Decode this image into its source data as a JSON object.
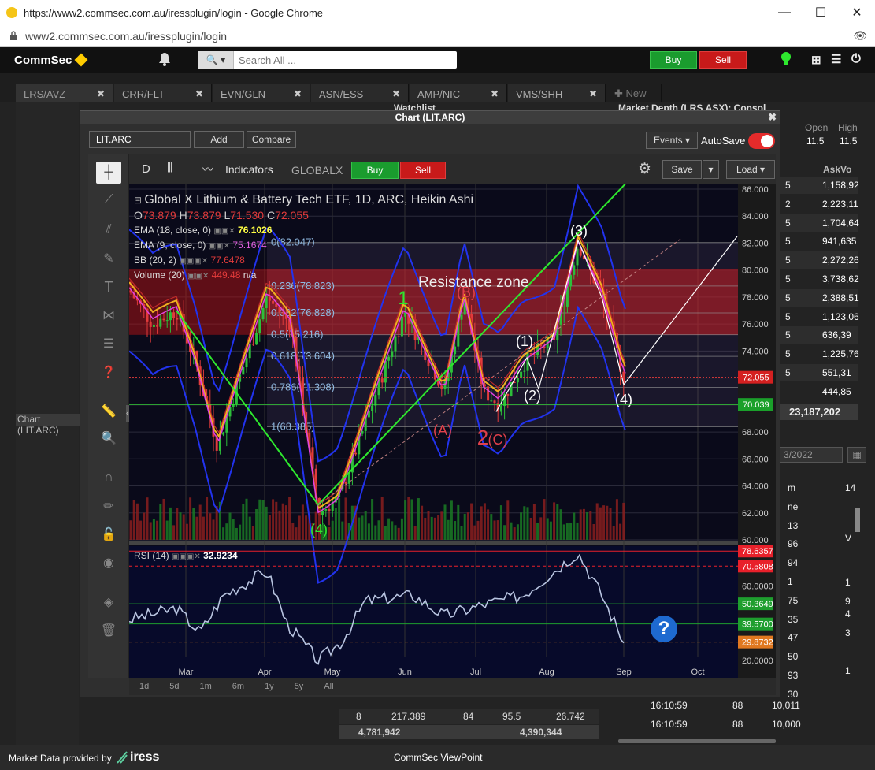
{
  "browser": {
    "title": "https://www2.commsec.com.au/iressplugin/login - Google Chrome",
    "url": "www2.commsec.com.au/iressplugin/login",
    "min": "—",
    "max": "☐",
    "close": "✕"
  },
  "header": {
    "logo": "CommSec",
    "search_placeholder": "Search All ...",
    "buy": "Buy",
    "sell": "Sell"
  },
  "tabs": [
    {
      "label": "LRS/AVZ"
    },
    {
      "label": "CRR/FLT"
    },
    {
      "label": "EVN/GLN"
    },
    {
      "label": "ASN/ESS"
    },
    {
      "label": "AMP/NIC"
    },
    {
      "label": "VMS/SHH"
    }
  ],
  "new_tab": "✚ New",
  "bg": {
    "watchlist": "Watchlist",
    "market_depth": "Market Depth (LRS.ASX): Consol...",
    "open_label": "Open",
    "high_label": "High",
    "open": "11.5",
    "high": "11.5",
    "askvol": "AskVo",
    "depth_vals": [
      "1,158,92",
      "2,223,11",
      "1,704,64",
      "941,635",
      "2,272,26",
      "3,738,62",
      "2,388,51",
      "1,123,06",
      "636,39",
      "1,225,76",
      "551,31",
      "444,85"
    ],
    "depth_idx": [
      "5",
      "2",
      "5",
      "5",
      "5",
      "5",
      "5",
      "5",
      "5",
      "5",
      "5"
    ],
    "depth_total": "23,187,202",
    "date_sel": "3/2022",
    "time_a": "16:10:59",
    "time_b": "16:10:59",
    "vol_a": "88",
    "vol_b": "88",
    "val_a": "10,011",
    "val_b": "10,000",
    "chart_side_label": "Chart (LIT.ARC)",
    "right_col": [
      "m",
      "ne",
      "13",
      "96",
      "94",
      "1",
      "75",
      "35",
      "47",
      "50",
      "93",
      "30"
    ],
    "right_col2": [
      "14",
      "V",
      "4",
      "3",
      "1",
      "1",
      "9"
    ],
    "bot_row": [
      "8",
      "217.389",
      "84",
      "95.5",
      "26.742"
    ],
    "bot_total_a": "4,781,942",
    "bot_total_b": "4,390,344"
  },
  "window": {
    "title": "Chart (LIT.ARC)",
    "symbol": "LIT.ARC",
    "add": "Add",
    "compare": "Compare",
    "events": "Events ▾",
    "autosave": "AutoSave"
  },
  "toolbar": {
    "interval": "D",
    "indicators": "Indicators",
    "exchange": "GLOBALX",
    "buy": "Buy",
    "sell": "Sell",
    "save": "Save",
    "load": "Load ▾"
  },
  "chart": {
    "title": "Global X Lithium & Battery Tech ETF, 1D, ARC, Heikin Ashi",
    "o_label": "O",
    "o": "73.879",
    "h_label": "H",
    "h": "73.879",
    "l_label": "L",
    "l": "71.530",
    "c_label": "C",
    "c": "72.055",
    "ema18": "EMA (18, close, 0)",
    "ema18_val": "76.1026",
    "ema9": "EMA (9, close, 0)",
    "ema9_val": "75.1674",
    "bb": "BB (20, 2)",
    "bb_val": "77.6478",
    "volume": "Volume (20)",
    "volume_val": "449.48",
    "volume_na": "n/a",
    "resistance": "Resistance zone",
    "fib": [
      {
        "label": "0(82.047)",
        "y": 82.047
      },
      {
        "label": "0.236(78.823)",
        "y": 78.823
      },
      {
        "label": "0.382(76.828)",
        "y": 76.828
      },
      {
        "label": "0.5(75.216)",
        "y": 75.216
      },
      {
        "label": "0.618(73.604)",
        "y": 73.604
      },
      {
        "label": "0.786(71.308)",
        "y": 71.308
      },
      {
        "label": "1(68.385)",
        "y": 68.385
      }
    ],
    "waves": [
      {
        "t": "1",
        "x": 512,
        "y": 380,
        "c": "#2ee82e",
        "s": 24
      },
      {
        "t": "(B)",
        "x": 592,
        "y": 371,
        "c": "#e0404a",
        "s": 18
      },
      {
        "t": "(A)",
        "x": 562,
        "y": 546,
        "c": "#e0404a",
        "s": 18
      },
      {
        "t": "2",
        "x": 613,
        "y": 558,
        "c": "#e0404a",
        "s": 26
      },
      {
        "t": "(C)",
        "x": 632,
        "y": 558,
        "c": "#e0404a",
        "s": 18
      },
      {
        "t": "(1)",
        "x": 666,
        "y": 433,
        "c": "#fff",
        "s": 18
      },
      {
        "t": "(2)",
        "x": 676,
        "y": 502,
        "c": "#fff",
        "s": 18
      },
      {
        "t": "(3)",
        "x": 735,
        "y": 293,
        "c": "#fff",
        "s": 18
      },
      {
        "t": "(4)",
        "x": 792,
        "y": 507,
        "c": "#fff",
        "s": 18
      },
      {
        "t": "(4)",
        "x": 405,
        "y": 672,
        "c": "#2ee82e",
        "s": 18
      }
    ],
    "ylim": [
      60,
      86
    ],
    "yticks": [
      "86.000",
      "84.000",
      "82.000",
      "80.000",
      "78.000",
      "76.000",
      "74.000",
      "72.000",
      "70.000",
      "68.000",
      "66.000",
      "64.000",
      "62.000",
      "60.000"
    ],
    "last_price": "72.055",
    "last_price_value": 72.055,
    "green_level": "70.039",
    "green_level_value": 70.039,
    "x_ticks": [
      "Mar",
      "Apr",
      "May",
      "Jun",
      "Jul",
      "Aug",
      "Sep",
      "Oct"
    ],
    "rsi": {
      "label": "RSI (14)",
      "value": "32.9234",
      "ticks": [
        {
          "t": "78.6357",
          "c": "#e8202a"
        },
        {
          "t": "70.5808",
          "c": "#e8202a"
        },
        {
          "t": "60.0000",
          "c": ""
        },
        {
          "t": "50.3649",
          "c": "#1e9e2e"
        },
        {
          "t": "39.5700",
          "c": "#1e9e2e"
        },
        {
          "t": "29.8732",
          "c": "#e07820"
        },
        {
          "t": "20.0000",
          "c": ""
        }
      ]
    },
    "ranges": [
      "1d",
      "5d",
      "1m",
      "6m",
      "1y",
      "5y",
      "All"
    ]
  },
  "footer": {
    "provider": "Market Data provided by",
    "brand": "iress",
    "center": "CommSec ViewPoint"
  },
  "colors": {
    "up": "#2cbf3a",
    "down": "#e23b3b",
    "accent": "#ffcc00"
  }
}
